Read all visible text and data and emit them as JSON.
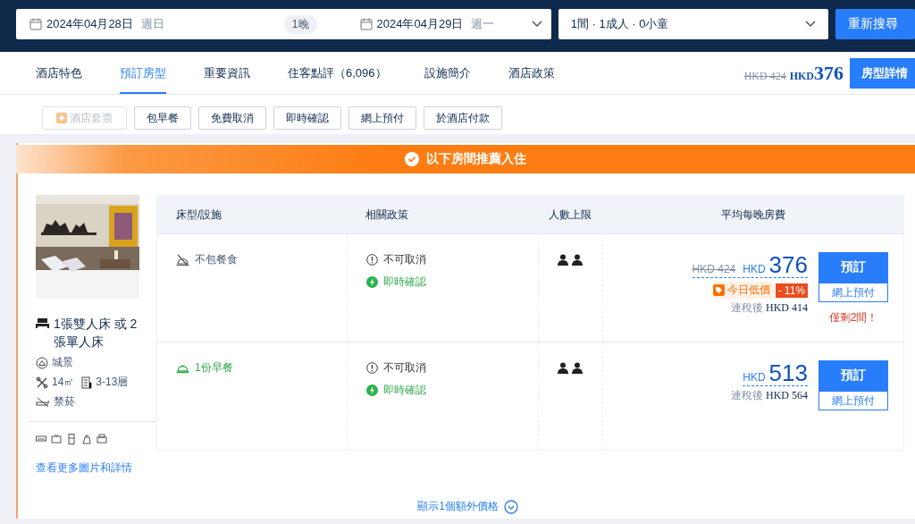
{
  "search": {
    "checkin_date": "2024年04月28日",
    "checkin_day": "週日",
    "nights": "1晚",
    "checkout_date": "2024年04月29日",
    "checkout_day": "週一",
    "guests": "1間 · 1成人 · 0小童",
    "search_button": "重新搜尋"
  },
  "tabs": [
    {
      "label": "酒店特色",
      "selected": false
    },
    {
      "label": "預訂房型",
      "selected": true
    },
    {
      "label": "重要資訊",
      "selected": false
    },
    {
      "label": "住客點評（6,096）",
      "selected": false
    },
    {
      "label": "設施簡介",
      "selected": false
    },
    {
      "label": "酒店政策",
      "selected": false
    }
  ],
  "header_price": {
    "original": "HKD 424",
    "currency": "HKD",
    "price": "376",
    "button": "房型詳情"
  },
  "filters": [
    {
      "label": "酒店套票",
      "disabled": true
    },
    {
      "label": "包早餐",
      "disabled": false
    },
    {
      "label": "免費取消",
      "disabled": false
    },
    {
      "label": "即時確認",
      "disabled": false
    },
    {
      "label": "網上預付",
      "disabled": false
    },
    {
      "label": "於酒店付款",
      "disabled": false
    }
  ],
  "banner": "以下房間推薦入住",
  "room": {
    "beds": "1張雙人床 或 2張單人床",
    "view": "城景",
    "size": "14㎡",
    "floors": "3-13層",
    "smoking": "禁菸",
    "more_link": "查看更多圖片和詳情"
  },
  "table": {
    "columns": [
      "床型/設施",
      "相關政策",
      "人數上限",
      "平均每晚房費"
    ],
    "rows": [
      {
        "meal": "不包餐食",
        "meal_included": false,
        "cancellation": "不可取消",
        "confirmation": "即時確認",
        "original_price": "HKD 424",
        "currency": "HKD",
        "price": "376",
        "deal_label": "今日低價",
        "discount": "- 11%",
        "after_tax_label": "連稅後",
        "after_tax": "HKD 414",
        "book_button": "預訂",
        "payment": "網上預付",
        "availability": "僅剩2間！"
      },
      {
        "meal": "1份早餐",
        "meal_included": true,
        "cancellation": "不可取消",
        "confirmation": "即時確認",
        "currency": "HKD",
        "price": "513",
        "after_tax_label": "連稅後",
        "after_tax": "HKD 564",
        "book_button": "預訂",
        "payment": "網上預付"
      }
    ]
  },
  "show_more": "顯示1個額外價格"
}
